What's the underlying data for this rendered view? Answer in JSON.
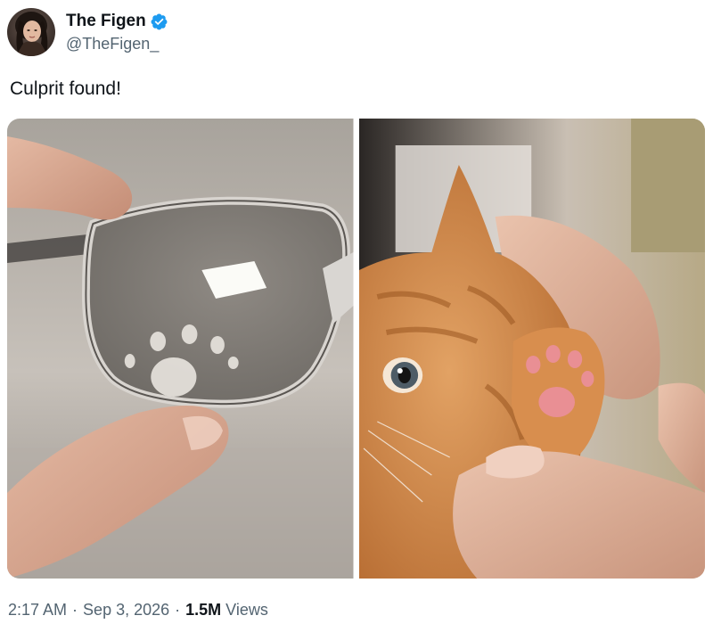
{
  "author": {
    "display_name": "The Figen",
    "handle": "@TheFigen_",
    "verified_badge_icon": "verified-badge-icon",
    "verified_color": "#1d9bf0"
  },
  "tweet": {
    "text": "Culprit found!",
    "media": [
      {
        "kind": "photo",
        "subject": "eyeglasses-lens-with-paw-print"
      },
      {
        "kind": "photo",
        "subject": "orange-kitten-paw-held-up"
      }
    ]
  },
  "meta": {
    "time": "2:17 AM",
    "separator": "·",
    "date": "Sep 3, 2026",
    "views_count": "1.5M",
    "views_label": "Views"
  },
  "colors": {
    "text_primary": "#0f1419",
    "text_secondary": "#536471",
    "accent": "#1d9bf0"
  }
}
